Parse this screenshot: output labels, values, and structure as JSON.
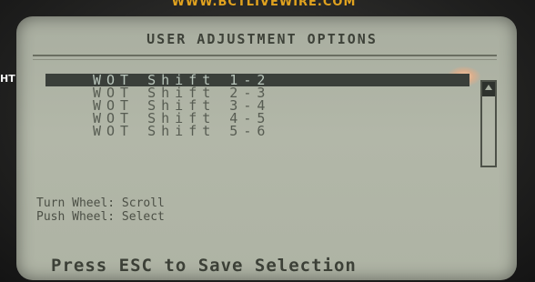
{
  "device": {
    "brand": "WWW.BCTLIVEWIRE.COM",
    "side_label": "HT"
  },
  "screen": {
    "title": "USER ADJUSTMENT OPTIONS",
    "menu": {
      "items": [
        {
          "label": "WOT Shift 1-2",
          "selected": true
        },
        {
          "label": "WOT Shift 2-3",
          "selected": false
        },
        {
          "label": "WOT Shift 3-4",
          "selected": false
        },
        {
          "label": "WOT Shift 4-5",
          "selected": false
        },
        {
          "label": "WOT Shift 5-6",
          "selected": false
        }
      ]
    },
    "help": {
      "turn": "Turn Wheel: Scroll",
      "push": "Push Wheel: Select"
    },
    "footer": "Press ESC to Save Selection"
  }
}
